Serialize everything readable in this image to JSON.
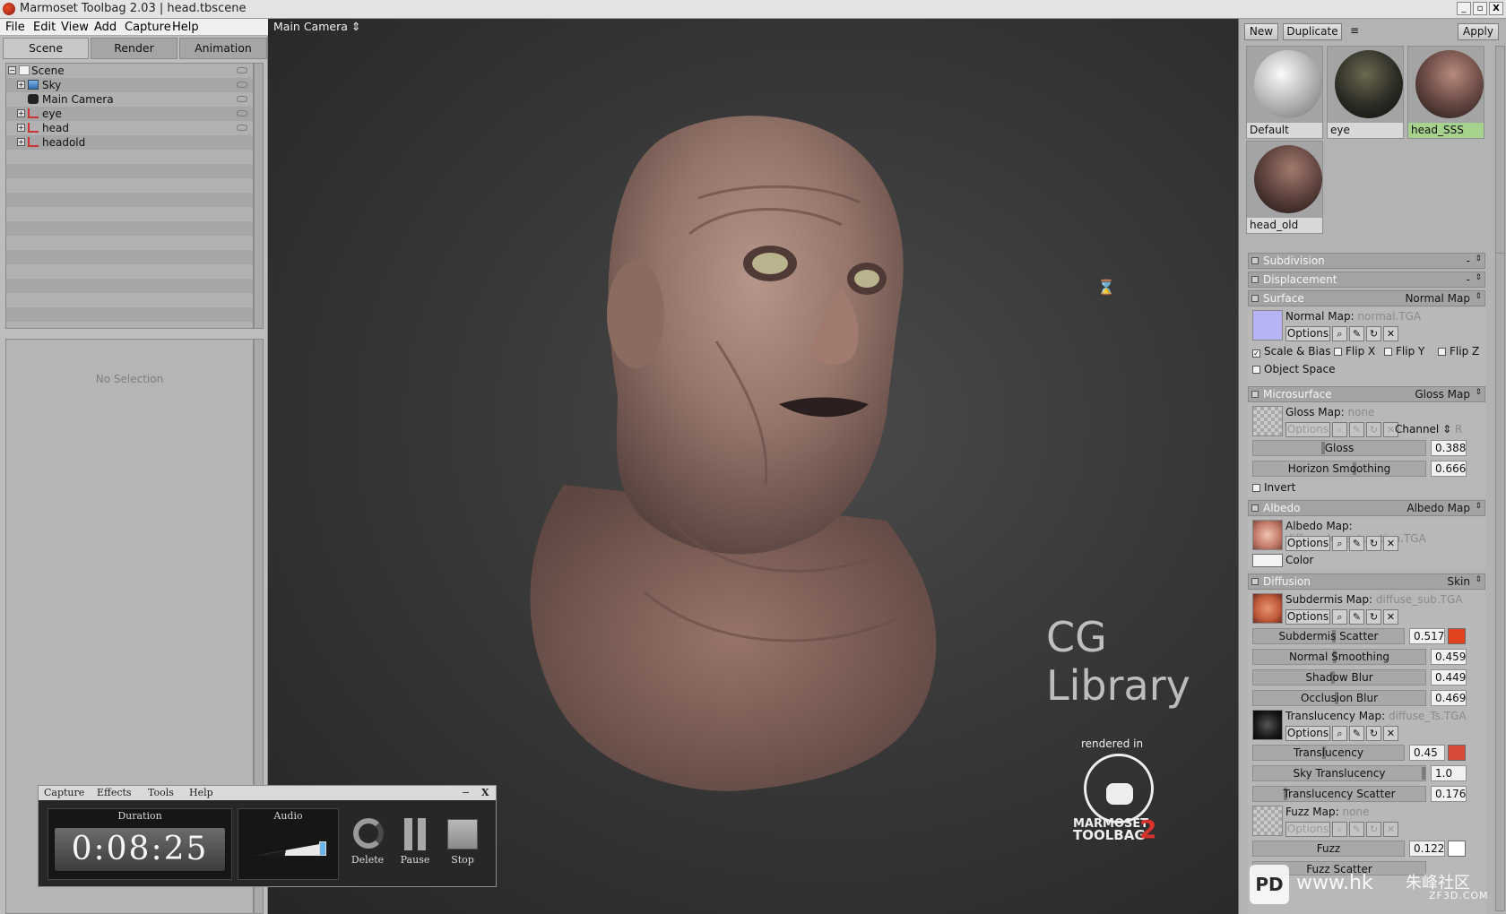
{
  "window": {
    "title": "Marmoset Toolbag 2.03  |  head.tbscene",
    "controls": [
      "_",
      "▫",
      "X"
    ]
  },
  "menubar": [
    "File",
    "Edit",
    "View",
    "Add",
    "Capture",
    "Help"
  ],
  "left_panel": {
    "tabs": [
      {
        "label": "Scene",
        "active": true
      },
      {
        "label": "Render",
        "active": false
      },
      {
        "label": "Animation",
        "active": false
      }
    ],
    "tree": [
      {
        "label": "Scene",
        "icon": "page-icon"
      },
      {
        "label": "Sky",
        "icon": "sky-icon"
      },
      {
        "label": "Main Camera",
        "icon": "camera-icon"
      },
      {
        "label": "eye",
        "icon": "mesh-icon"
      },
      {
        "label": "head",
        "icon": "mesh-icon"
      },
      {
        "label": "headold",
        "icon": "mesh-icon"
      }
    ],
    "no_selection": "No Selection"
  },
  "viewport": {
    "camera_label": "Main Camera ⇕",
    "watermark": "CG Library",
    "rendered_in": "rendered in",
    "logo_line1": "MARMOSET",
    "logo_line2": "TOOLBAG",
    "logo_num": "2",
    "site_text": "www.hk",
    "site_sub": "ZF3D.COM",
    "site_tag": "朱峰社区",
    "pd_logo": "PD"
  },
  "material_panel": {
    "new_label": "New",
    "duplicate_label": "Duplicate",
    "menu_icon": "≡",
    "apply_label": "Apply",
    "materials": [
      {
        "name": "Default",
        "selected": false
      },
      {
        "name": "eye",
        "selected": false
      },
      {
        "name": "head_SSS",
        "selected": true
      },
      {
        "name": "head_old",
        "selected": false
      }
    ],
    "sections": {
      "subdivision": {
        "title": "Subdivision",
        "value": "-"
      },
      "displacement": {
        "title": "Displacement",
        "value": "-"
      },
      "surface": {
        "title": "Surface",
        "value": "Normal Map",
        "map_label": "Normal Map:",
        "map_file": "normal.TGA",
        "options": "Options",
        "scale_bias": "Scale & Bias",
        "flip_x": "Flip X",
        "flip_y": "Flip Y",
        "flip_z": "Flip Z",
        "object_space": "Object Space"
      },
      "microsurface": {
        "title": "Microsurface",
        "value": "Gloss Map",
        "map_label": "Gloss Map:",
        "map_file": "none",
        "options": "Options",
        "channel": "Channel ⇕",
        "channel_value": "R",
        "gloss_label": "Gloss",
        "gloss_value": "0.388",
        "horizon_label": "Horizon Smoothing",
        "horizon_value": "0.666",
        "invert": "Invert"
      },
      "albedo": {
        "title": "Albedo",
        "value": "Albedo Map",
        "map_label": "Albedo Map:",
        "map_file": "diffuse_lowsaturation.TGA",
        "options": "Options",
        "color_label": "Color"
      },
      "diffusion": {
        "title": "Diffusion",
        "value": "Skin",
        "subdermis_label": "Subdermis Map:",
        "subdermis_file": "diffuse_sub.TGA",
        "options": "Options",
        "subdermis_scatter_label": "Subdermis Scatter",
        "subdermis_scatter_value": "0.517",
        "normal_smoothing_label": "Normal Smoothing",
        "normal_smoothing_value": "0.459",
        "shadow_blur_label": "Shadow Blur",
        "shadow_blur_value": "0.449",
        "occlusion_blur_label": "Occlusion Blur",
        "occlusion_blur_value": "0.469",
        "translucency_map_label": "Translucency Map:",
        "translucency_map_file": "diffuse_Ts.TGA",
        "translucency_label": "Translucency",
        "translucency_value": "0.45",
        "sky_translucency_label": "Sky Translucency",
        "sky_translucency_value": "1.0",
        "translucency_scatter_label": "Translucency Scatter",
        "translucency_scatter_value": "0.176",
        "fuzz_map_label": "Fuzz Map:",
        "fuzz_map_file": "none",
        "fuzz_label": "Fuzz",
        "fuzz_value": "0.122",
        "fuzz_scatter_label": "Fuzz Scatter"
      }
    },
    "colors": {
      "subdermis_swatch": "#e0441e",
      "translucency_swatch": "#d94a3a",
      "fuzz_swatch": "#ffffff",
      "color_swatch": "#f3f3f3",
      "normal_thumb": "#b7b4f5",
      "selected_material": "#a6d28e"
    }
  },
  "recorder": {
    "menu": [
      "Capture",
      "Effects",
      "Tools",
      "Help"
    ],
    "min": "−",
    "close": "X",
    "duration_label": "Duration",
    "duration_value": "0:08:25",
    "audio_label": "Audio",
    "controls": [
      {
        "label": "Delete",
        "icon": "refresh-icon"
      },
      {
        "label": "Pause",
        "icon": "pause-icon"
      },
      {
        "label": "Stop",
        "icon": "stop-icon"
      }
    ]
  }
}
